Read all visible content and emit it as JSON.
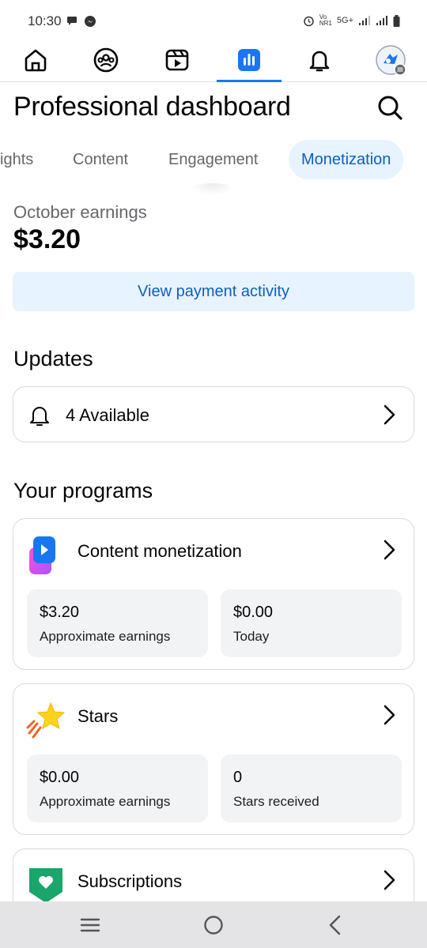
{
  "status_bar": {
    "time": "10:30",
    "network": "5G+",
    "carrier_top": "Vo",
    "carrier_bottom": "NR1"
  },
  "nav": {
    "items": [
      "home",
      "groups",
      "video",
      "dashboard",
      "notifications",
      "profile"
    ],
    "active": "dashboard"
  },
  "header": {
    "title": "Professional dashboard"
  },
  "tabs": [
    {
      "label": "ights"
    },
    {
      "label": "Content"
    },
    {
      "label": "Engagement"
    },
    {
      "label": "Monetization",
      "active": true
    }
  ],
  "earnings": {
    "label": "October earnings",
    "value": "$3.20",
    "button": "View payment activity"
  },
  "updates": {
    "title": "Updates",
    "text": "4 Available"
  },
  "programs": {
    "title": "Your programs",
    "items": [
      {
        "name": "Content monetization",
        "stats": [
          {
            "value": "$3.20",
            "label": "Approximate earnings"
          },
          {
            "value": "$0.00",
            "label": "Today"
          }
        ]
      },
      {
        "name": "Stars",
        "stats": [
          {
            "value": "$0.00",
            "label": "Approximate earnings"
          },
          {
            "value": "0",
            "label": "Stars received"
          }
        ]
      },
      {
        "name": "Subscriptions"
      }
    ]
  },
  "colors": {
    "accent": "#1877f2",
    "accent_text": "#0b5fc4",
    "accent_bg": "#e7f3ff",
    "card_bg": "#f2f3f5"
  }
}
